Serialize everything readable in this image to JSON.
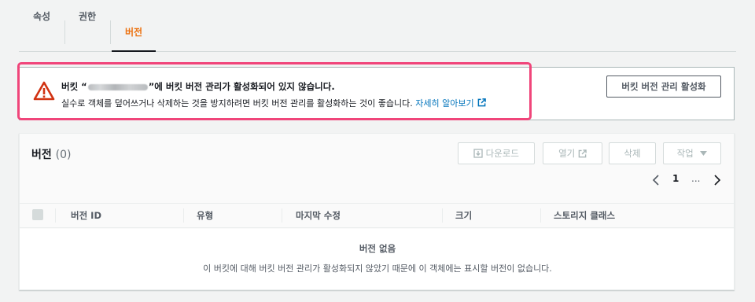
{
  "tabs": [
    {
      "label": "속성",
      "active": false
    },
    {
      "label": "권한",
      "active": false
    },
    {
      "label": "버전",
      "active": true
    }
  ],
  "alert": {
    "title_prefix": "버킷 “",
    "title_suffix": "”에 버킷 버전 관리가 활성화되어 있지 않습니다.",
    "description": "실수로 객체를 덮어쓰거나 삭제하는 것을 방지하려면 버킷 버전 관리를 활성화하는 것이 좋습니다. ",
    "learn_more": "자세히 알아보기",
    "action_label": "버킷 버전 관리 활성화",
    "icon": "warning-icon",
    "accent": "#d13212",
    "highlight_color": "#f0457a"
  },
  "panel": {
    "title": "버전",
    "count": "(0)",
    "buttons": {
      "download": "다운로드",
      "open": "열기",
      "delete": "삭제",
      "actions": "작업"
    },
    "pagination": {
      "current": "1",
      "ellipsis": "..."
    }
  },
  "table": {
    "columns": [
      "버전 ID",
      "유형",
      "마지막 수정",
      "크기",
      "스토리지 클래스"
    ],
    "empty_title": "버전 없음",
    "empty_description": "이 버킷에 대해 버킷 버전 관리가 활성화되지 않았기 때문에 이 객체에는 표시할 버전이 없습니다."
  }
}
